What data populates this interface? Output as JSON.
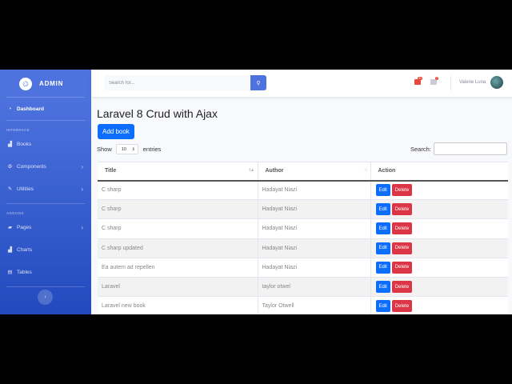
{
  "sidebar": {
    "brand": "ADMIN",
    "items": [
      {
        "label": "Dashboard"
      },
      {
        "label": "Books"
      },
      {
        "label": "Components"
      },
      {
        "label": "Utilities"
      },
      {
        "label": "Pages"
      },
      {
        "label": "Charts"
      },
      {
        "label": "Tables"
      }
    ],
    "headings": [
      "INTERFACE",
      "ADDONS"
    ]
  },
  "topbar": {
    "search_placeholder": "Search for...",
    "alerts_count": "3+",
    "messages_count": "7",
    "user_name": "Valerie Luna"
  },
  "main": {
    "title": "Laravel 8 Crud with Ajax",
    "add_button": "Add book",
    "show_label": "Show",
    "entries_value": "10",
    "entries_label": "entries",
    "search_label": "Search:",
    "columns": [
      "Title",
      "Author",
      "Action"
    ],
    "rows": [
      {
        "title": "C sharp",
        "author": "Hadayat Niazi"
      },
      {
        "title": "C sharp",
        "author": "Hadayat Niazi"
      },
      {
        "title": "C sharp",
        "author": "Hadayat Niazi"
      },
      {
        "title": "C sharp updated",
        "author": "Hadayat Niazi"
      },
      {
        "title": "Ea autem ad repellen",
        "author": "Hadayat Niazi"
      },
      {
        "title": "Laravel",
        "author": "taylor otwel"
      },
      {
        "title": "Laravel new book",
        "author": "Taylor Otwell"
      }
    ],
    "edit_label": "Edit",
    "delete_label": "Delete"
  }
}
